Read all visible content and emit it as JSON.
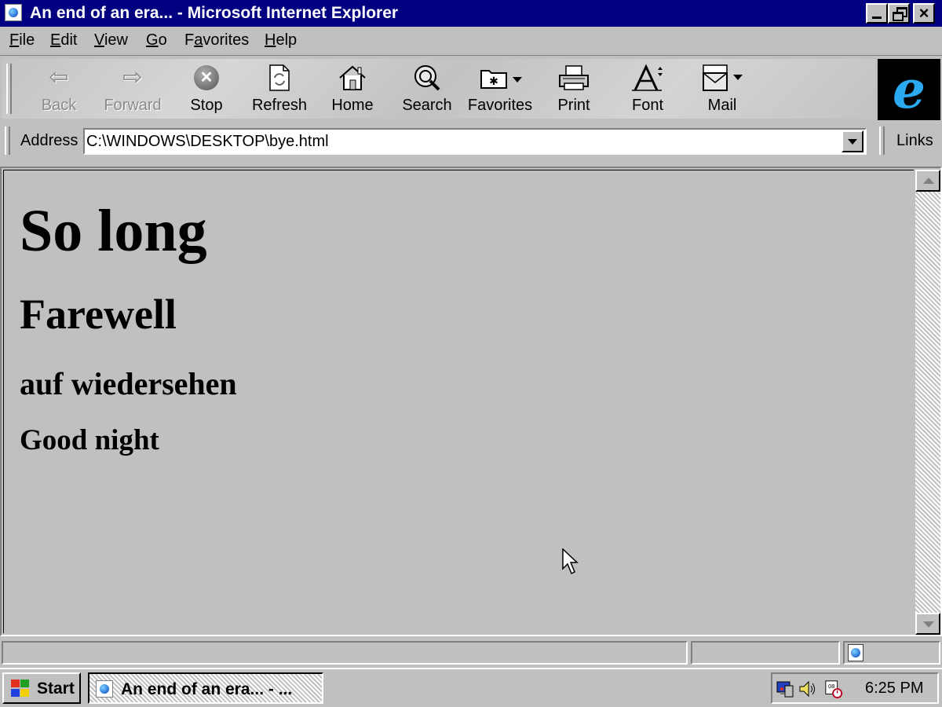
{
  "window": {
    "title": "An end of an era... - Microsoft Internet Explorer",
    "icon": "ie-page-icon"
  },
  "menu": {
    "items": [
      {
        "label_u": "F",
        "label_rest": "ile"
      },
      {
        "label_u": "E",
        "label_rest": "dit"
      },
      {
        "label_u": "V",
        "label_rest": "iew"
      },
      {
        "label_u": "G",
        "label_rest": "o"
      },
      {
        "label_pre": "F",
        "label_u": "a",
        "label_rest": "vorites"
      },
      {
        "label_u": "H",
        "label_rest": "elp"
      }
    ]
  },
  "toolbar": {
    "buttons": [
      {
        "label": "Back",
        "icon": "back-arrow-icon",
        "enabled": false
      },
      {
        "label": "Forward",
        "icon": "forward-arrow-icon",
        "enabled": false
      },
      {
        "label": "Stop",
        "icon": "stop-icon",
        "enabled": true
      },
      {
        "label": "Refresh",
        "icon": "refresh-icon",
        "enabled": true
      },
      {
        "label": "Home",
        "icon": "home-icon",
        "enabled": true
      },
      {
        "label": "Search",
        "icon": "search-icon",
        "enabled": true
      },
      {
        "label": "Favorites",
        "icon": "favorites-icon",
        "enabled": true
      },
      {
        "label": "Print",
        "icon": "printer-icon",
        "enabled": true
      },
      {
        "label": "Font",
        "icon": "font-icon",
        "enabled": true
      },
      {
        "label": "Mail",
        "icon": "mail-icon",
        "enabled": true
      }
    ]
  },
  "address": {
    "label": "Address",
    "value": "C:\\WINDOWS\\DESKTOP\\bye.html"
  },
  "links": {
    "label": "Links"
  },
  "page": {
    "h1": "So long",
    "h2": "Farewell",
    "h3": "auf wiedersehen",
    "h4": "Good night"
  },
  "statusbar": {
    "text": "",
    "zone_icon": "internet-zone-icon"
  },
  "taskbar": {
    "start_label": "Start",
    "task_label": "An end of an era... - ...",
    "clock": "6:25 PM"
  },
  "colors": {
    "titlebar": "#000080",
    "face": "#c0c0c0",
    "ie_logo": "#2aa8f0"
  }
}
